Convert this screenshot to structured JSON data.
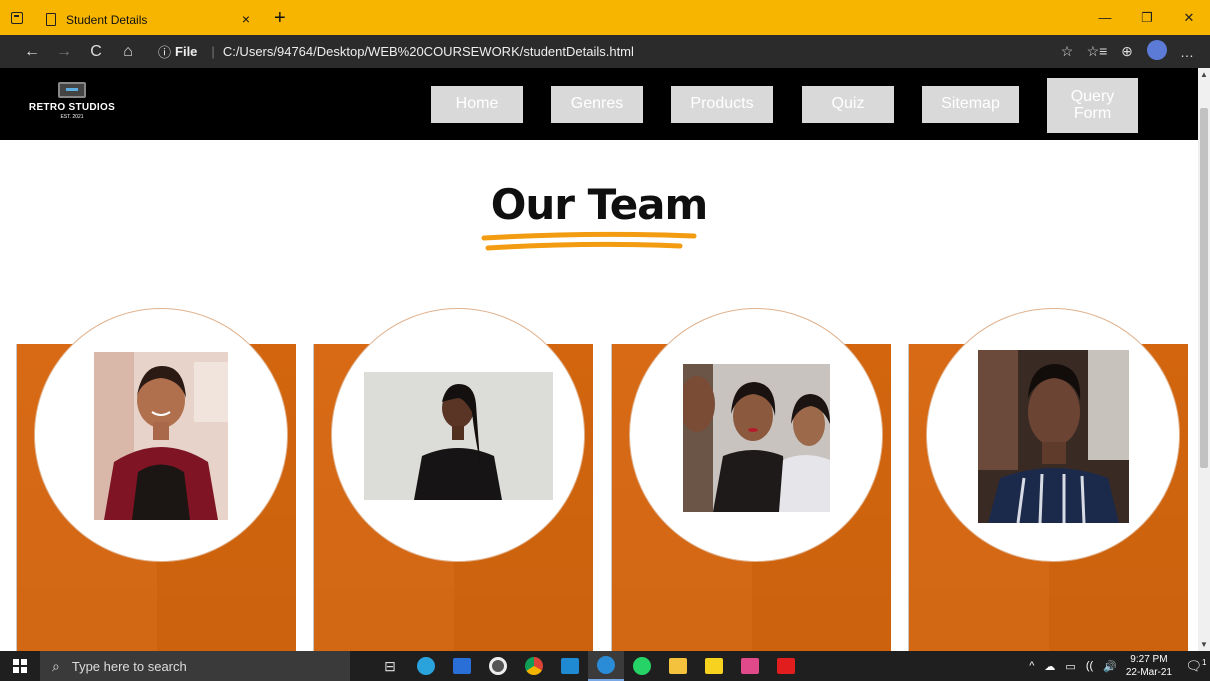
{
  "browser": {
    "tab_title": "Student Details",
    "tab_close": "×",
    "new_tab": "+",
    "window_controls": [
      "—",
      "❐",
      "✕"
    ],
    "nav": {
      "back": "←",
      "forward": "→",
      "refresh": "C",
      "home": "⌂"
    },
    "info_icon": "ⓘ",
    "file_label": "File",
    "separator": "|",
    "url": "C:/Users/94764/Desktop/WEB%20COURSEWORK/studentDetails.html",
    "toolbar_icons": [
      "☆",
      "☆≡",
      "⊕",
      "profile",
      "…"
    ]
  },
  "site": {
    "logo": {
      "name": "RETRO STUDIOS",
      "est": "EST. 2021"
    },
    "nav": [
      {
        "label": "Home"
      },
      {
        "label": "Genres"
      },
      {
        "label": "Products"
      },
      {
        "label": "Quiz"
      },
      {
        "label": "Sitemap"
      },
      {
        "label": "Query Form"
      }
    ],
    "title": "Our Team",
    "accent": "#f39c12",
    "card_color": "#d86a15",
    "team": [
      {
        "photo": "team-member-1"
      },
      {
        "photo": "team-member-2"
      },
      {
        "photo": "team-member-3"
      },
      {
        "photo": "team-member-4"
      }
    ]
  },
  "taskbar": {
    "search_placeholder": "Type here to search",
    "apps": [
      "task-view",
      "telegram",
      "mail",
      "media",
      "chrome",
      "vscode",
      "edge",
      "whatsapp",
      "file-explorer",
      "sticky-notes",
      "intellij",
      "acrobat"
    ],
    "tray_icons": [
      "^",
      "☁",
      "▭",
      "((",
      "🔊"
    ],
    "time": "9:27 PM",
    "date": "22-Mar-21",
    "notification_count": "1"
  }
}
